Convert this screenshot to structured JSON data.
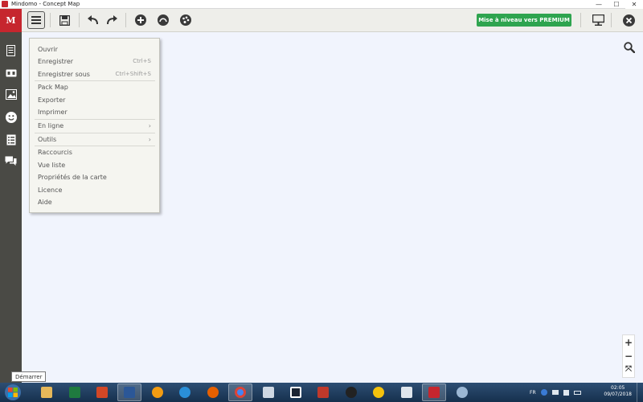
{
  "window": {
    "title": "Mindomo - Concept Map",
    "minimize": "—",
    "maximize": "☐",
    "close": "✕"
  },
  "toolbar": {
    "logo_text": "M",
    "premium_label": "Mise à niveau vers PREMIUM"
  },
  "menu": {
    "items": [
      {
        "label": "Ouvrir",
        "shortcut": ""
      },
      {
        "label": "Enregistrer",
        "shortcut": "Ctrl+S"
      },
      {
        "label": "Enregistrer sous",
        "shortcut": "Ctrl+Shift+S"
      },
      {
        "label": "Pack Map",
        "shortcut": ""
      },
      {
        "label": "Exporter",
        "shortcut": ""
      },
      {
        "label": "Imprimer",
        "shortcut": ""
      },
      {
        "label": "En ligne",
        "submenu": "›"
      },
      {
        "label": "Outils",
        "submenu": "›"
      },
      {
        "label": "Raccourcis",
        "shortcut": ""
      },
      {
        "label": "Vue liste",
        "shortcut": ""
      },
      {
        "label": "Propriétés de la carte",
        "shortcut": ""
      },
      {
        "label": "Licence",
        "shortcut": ""
      },
      {
        "label": "Aide",
        "shortcut": ""
      }
    ]
  },
  "zoom": {
    "plus": "+",
    "minus": "−",
    "fit": "⤧"
  },
  "tooltip": {
    "text": "Démarrer"
  },
  "taskbar": {
    "language": "FR",
    "time": "02:05",
    "date": "09/07/2018"
  },
  "colors": {
    "accent_red": "#c6262e",
    "premium_green": "#2ea44f",
    "canvas_bg": "#f1f4fd",
    "sidebar_bg": "#4a4a45"
  }
}
